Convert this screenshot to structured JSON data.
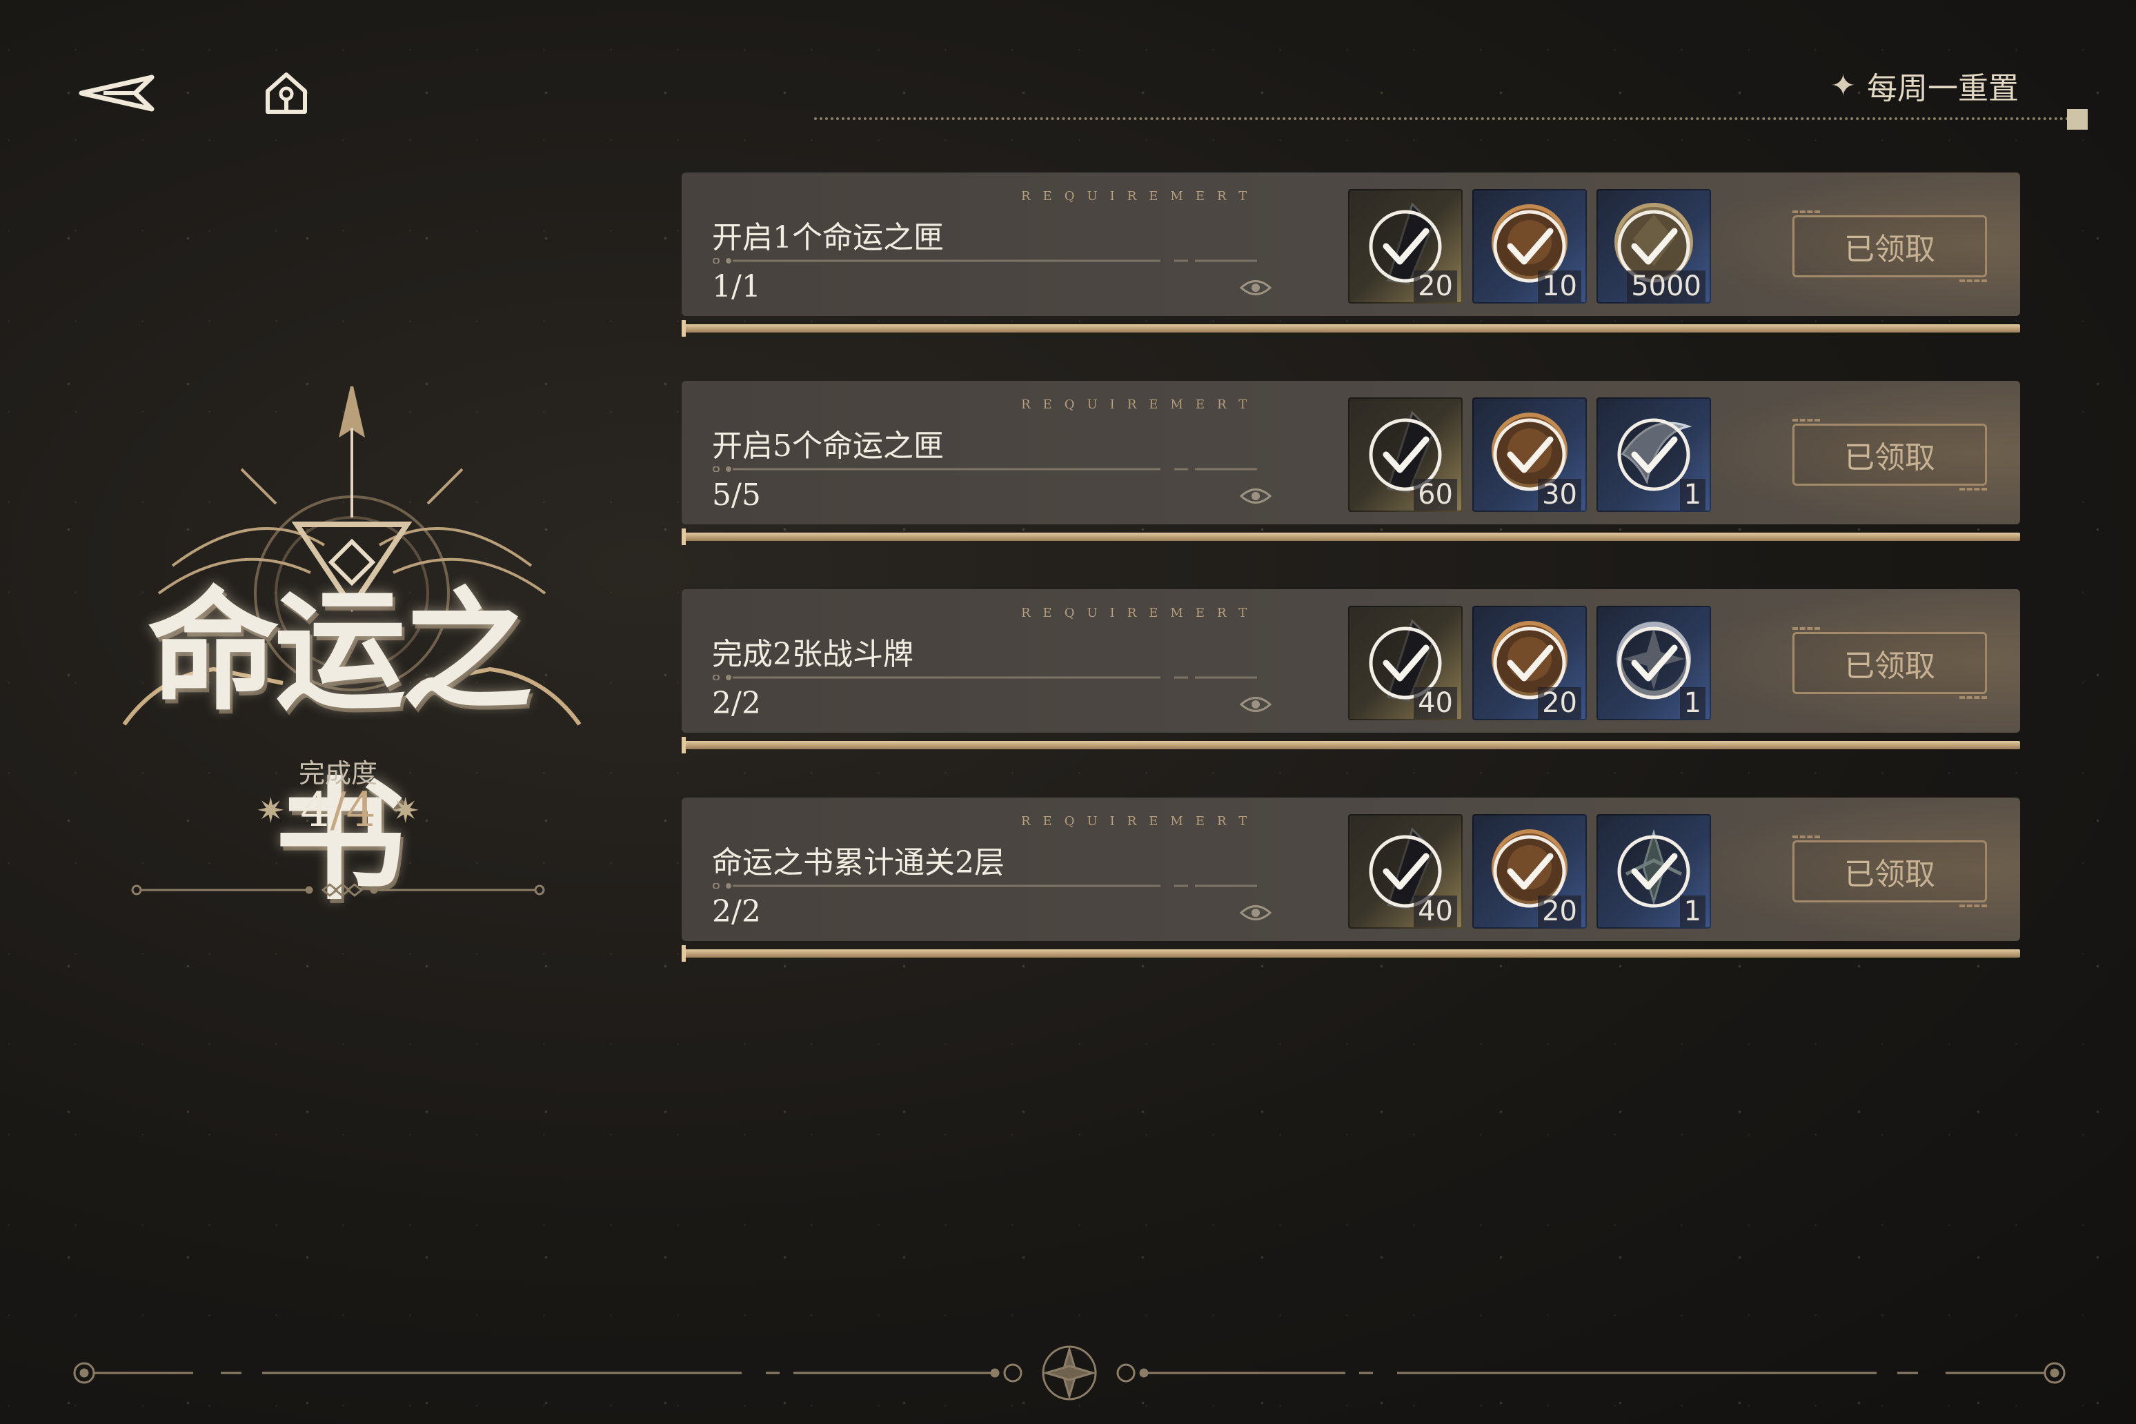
{
  "header": {
    "back_icon": "back-arrow-icon",
    "home_icon": "home-icon",
    "weekly_reset_label": "每周一重置"
  },
  "left_panel": {
    "logo_text": "命运之书",
    "completion_label": "完成度",
    "completion_current": "4",
    "completion_separator": "/",
    "completion_total": "4"
  },
  "tasks": [
    {
      "requirement_tag": "REQUIREMERT",
      "title": "开启1个命运之匣",
      "progress": "1/1",
      "rewards": [
        {
          "icon": "dark-crystal-icon",
          "qty": "20",
          "frame": "gold"
        },
        {
          "icon": "bronze-coin-icon",
          "qty": "10",
          "frame": "blue"
        },
        {
          "icon": "gold-coin-icon",
          "qty": "5000",
          "frame": "blue"
        }
      ],
      "button_label": "已领取"
    },
    {
      "requirement_tag": "REQUIREMERT",
      "title": "开启5个命运之匣",
      "progress": "5/5",
      "rewards": [
        {
          "icon": "dark-crystal-icon",
          "qty": "60",
          "frame": "gold"
        },
        {
          "icon": "bronze-coin-icon",
          "qty": "30",
          "frame": "blue"
        },
        {
          "icon": "silver-feather-icon",
          "qty": "1",
          "frame": "blue"
        }
      ],
      "button_label": "已领取"
    },
    {
      "requirement_tag": "REQUIREMERT",
      "title": "完成2张战斗牌",
      "progress": "2/2",
      "rewards": [
        {
          "icon": "dark-crystal-icon",
          "qty": "40",
          "frame": "gold"
        },
        {
          "icon": "bronze-coin-icon",
          "qty": "20",
          "frame": "blue"
        },
        {
          "icon": "silver-emblem-icon",
          "qty": "1",
          "frame": "blue"
        }
      ],
      "button_label": "已领取"
    },
    {
      "requirement_tag": "REQUIREMERT",
      "title": "命运之书累计通关2层",
      "progress": "2/2",
      "rewards": [
        {
          "icon": "dark-crystal-icon",
          "qty": "40",
          "frame": "gold"
        },
        {
          "icon": "bronze-coin-icon",
          "qty": "20",
          "frame": "blue"
        },
        {
          "icon": "star-sigil-icon",
          "qty": "1",
          "frame": "blue"
        }
      ],
      "button_label": "已领取"
    }
  ],
  "colors": {
    "background": "#1a1815",
    "panel": "#4a453f",
    "accent_gold": "#d9bf92",
    "button_border": "#a48c6d"
  }
}
